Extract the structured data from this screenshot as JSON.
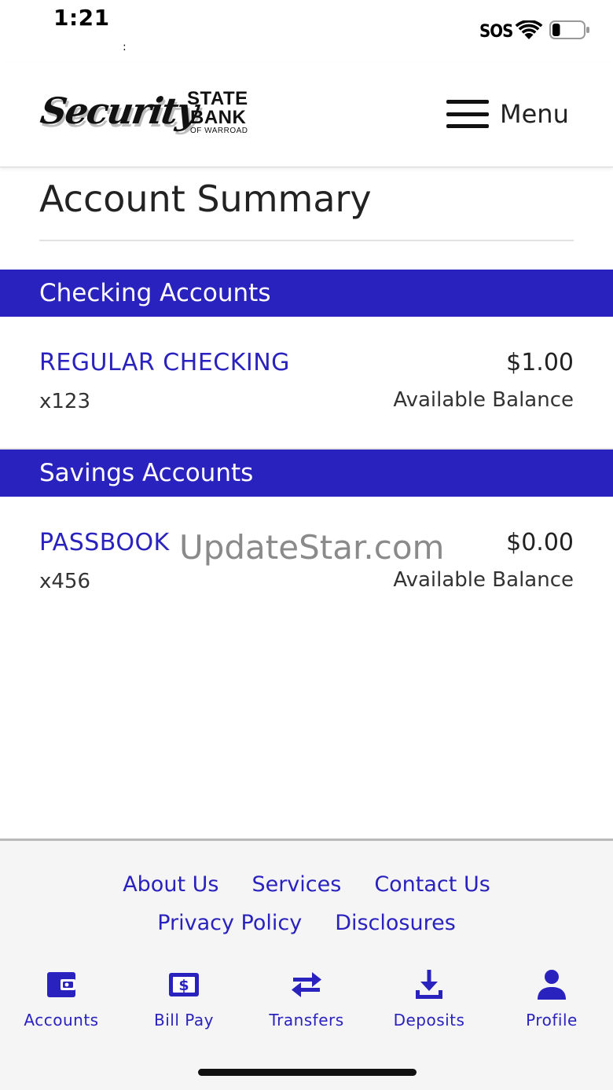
{
  "status_bar": {
    "time": "1:21",
    "dot": ":",
    "carrier": "SOS",
    "wifi_icon": "wifi-icon",
    "battery_icon": "battery-icon",
    "battery_level_fraction": 0.25
  },
  "header": {
    "logo": {
      "script": "Security",
      "state": "STATE",
      "bank": "BANK",
      "sub": "OF WARROAD"
    },
    "menu_label": "Menu",
    "menu_icon": "hamburger-icon"
  },
  "page": {
    "title": "Account Summary"
  },
  "sections": [
    {
      "title": "Checking Accounts",
      "accounts": [
        {
          "name": "REGULAR CHECKING",
          "number": "x123",
          "balance": "$1.00",
          "balance_label": "Available Balance"
        }
      ]
    },
    {
      "title": "Savings Accounts",
      "accounts": [
        {
          "name": "PASSBOOK",
          "number": "x456",
          "balance": "$0.00",
          "balance_label": "Available Balance"
        }
      ]
    }
  ],
  "watermark": "UpdateStar.com",
  "footer": {
    "links_row1": [
      "About Us",
      "Services",
      "Contact Us"
    ],
    "links_row2": [
      "Privacy Policy",
      "Disclosures"
    ],
    "tabs": [
      {
        "label": "Accounts",
        "icon": "wallet-icon"
      },
      {
        "label": "Bill Pay",
        "icon": "bill-icon"
      },
      {
        "label": "Transfers",
        "icon": "transfer-arrows-icon"
      },
      {
        "label": "Deposits",
        "icon": "download-icon"
      },
      {
        "label": "Profile",
        "icon": "person-icon"
      }
    ]
  },
  "colors": {
    "accent": "#2a22be",
    "footer_bg": "#f5f5f5",
    "text": "#222222"
  }
}
